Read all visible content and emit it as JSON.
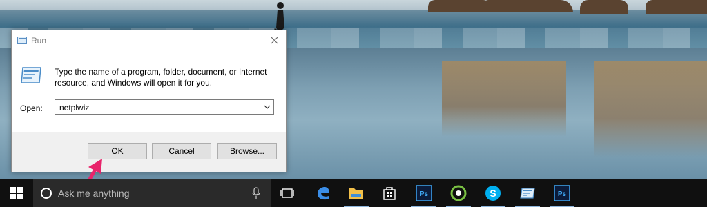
{
  "dialog": {
    "title": "Run",
    "description": "Type the name of a program, folder, document, or Internet resource, and Windows will open it for you.",
    "open_label_hotkey": "O",
    "open_label_rest": "pen:",
    "open_value": "netplwiz",
    "buttons": {
      "ok": "OK",
      "cancel": "Cancel",
      "browse_hotkey": "B",
      "browse_rest": "rowse..."
    }
  },
  "taskbar": {
    "search_placeholder": "Ask me anything",
    "pinned": [
      "task-view",
      "edge",
      "file-explorer",
      "store",
      "photoshop",
      "greenshot",
      "skype",
      "remote-desktop",
      "photoshop"
    ]
  },
  "colors": {
    "taskbar_bg": "#101010",
    "annotation_arrow": "#e8246b",
    "dialog_button_bg": "#e1e1e1"
  }
}
